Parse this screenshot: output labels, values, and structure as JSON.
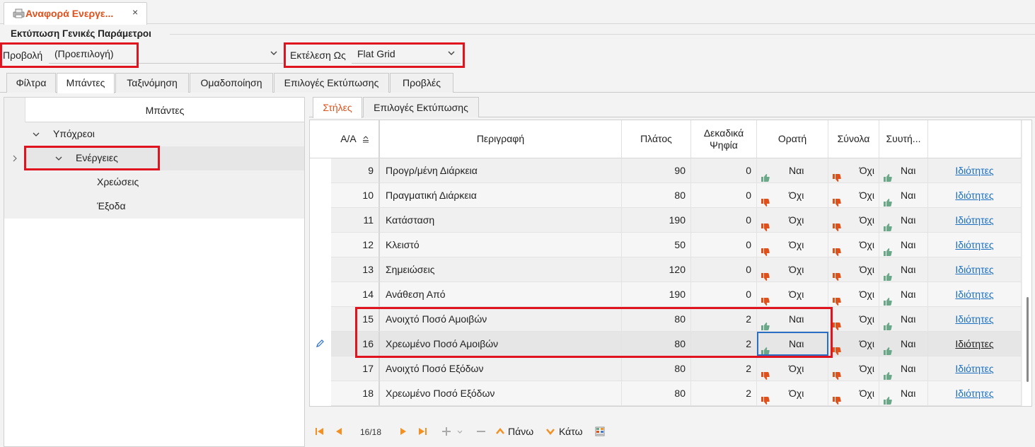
{
  "document_tab": {
    "title": "Αναφορά Ενεργε...",
    "close": "×"
  },
  "section": {
    "title": "Εκτύπωση Γενικές Παράμετροι"
  },
  "params": {
    "view_label": "Προβολή",
    "view_value": "(Προεπιλογή)",
    "execute_label": "Εκτέλεση Ως",
    "execute_value": "Flat Grid"
  },
  "main_tabs": [
    {
      "label": "Φίλτρα"
    },
    {
      "label": "Μπάντες"
    },
    {
      "label": "Ταξινόμηση"
    },
    {
      "label": "Ομαδοποίηση"
    },
    {
      "label": "Επιλογές Εκτύπωσης"
    },
    {
      "label": "Προβλές"
    }
  ],
  "bands_tree": {
    "header": "Μπάντες",
    "nodes": [
      {
        "label": "Υπόχρεοι"
      },
      {
        "label": "Ενέργειες"
      },
      {
        "label": "Χρεώσεις"
      },
      {
        "label": "Έξοδα"
      }
    ]
  },
  "sub_tabs": [
    {
      "label": "Στήλες"
    },
    {
      "label": "Επιλογές Εκτύπωσης"
    }
  ],
  "grid": {
    "headers": {
      "aa": "Α/Α",
      "desc": "Περιγραφή",
      "width": "Πλάτος",
      "decimals_line1": "Δεκαδικά",
      "decimals_line2": "Ψηφία",
      "visible": "Ορατή",
      "totals": "Σύνολα",
      "group": "Συυτή..."
    },
    "rows": [
      {
        "aa": "9",
        "desc": "Προγρ/μένη Διάρκεια",
        "width": "90",
        "dec": "0",
        "visible": "Ναι",
        "totals": "Όχι",
        "group": "Ναι",
        "link": "Ιδιότητες"
      },
      {
        "aa": "10",
        "desc": "Πραγματική Διάρκεια",
        "width": "80",
        "dec": "0",
        "visible": "Όχι",
        "totals": "Όχι",
        "group": "Ναι",
        "link": "Ιδιότητες"
      },
      {
        "aa": "11",
        "desc": "Κατάσταση",
        "width": "190",
        "dec": "0",
        "visible": "Όχι",
        "totals": "Όχι",
        "group": "Ναι",
        "link": "Ιδιότητες"
      },
      {
        "aa": "12",
        "desc": "Κλειστό",
        "width": "50",
        "dec": "0",
        "visible": "Όχι",
        "totals": "Όχι",
        "group": "Ναι",
        "link": "Ιδιότητες"
      },
      {
        "aa": "13",
        "desc": "Σημειώσεις",
        "width": "120",
        "dec": "0",
        "visible": "Όχι",
        "totals": "Όχι",
        "group": "Ναι",
        "link": "Ιδιότητες"
      },
      {
        "aa": "14",
        "desc": "Ανάθεση Από",
        "width": "190",
        "dec": "0",
        "visible": "Όχι",
        "totals": "Όχι",
        "group": "Ναι",
        "link": "Ιδιότητες"
      },
      {
        "aa": "15",
        "desc": "Ανοιχτό Ποσό Αμοιβών",
        "width": "80",
        "dec": "2",
        "visible": "Ναι",
        "totals": "Όχι",
        "group": "Ναι",
        "link": "Ιδιότητες"
      },
      {
        "aa": "16",
        "desc": "Χρεωμένο Ποσό Αμοιβών",
        "width": "80",
        "dec": "2",
        "visible": "Ναι",
        "totals": "Όχι",
        "group": "Ναι",
        "link": "Ιδιότητες"
      },
      {
        "aa": "17",
        "desc": "Ανοιχτό Ποσό Εξόδων",
        "width": "80",
        "dec": "2",
        "visible": "Όχι",
        "totals": "Όχι",
        "group": "Ναι",
        "link": "Ιδιότητες"
      },
      {
        "aa": "18",
        "desc": "Χρεωμένο Ποσό Εξόδων",
        "width": "80",
        "dec": "2",
        "visible": "Όχι",
        "totals": "Όχι",
        "group": "Ναι",
        "link": "Ιδιότητες"
      }
    ]
  },
  "navigator": {
    "page_info": "16/18",
    "up_label": "Πάνω",
    "down_label": "Κάτω"
  },
  "colors": {
    "accent": "#e0501b",
    "highlight_red": "#e0141e",
    "thumb_up": "#6aa889",
    "thumb_down": "#e0501b",
    "link": "#1a6fc0"
  }
}
